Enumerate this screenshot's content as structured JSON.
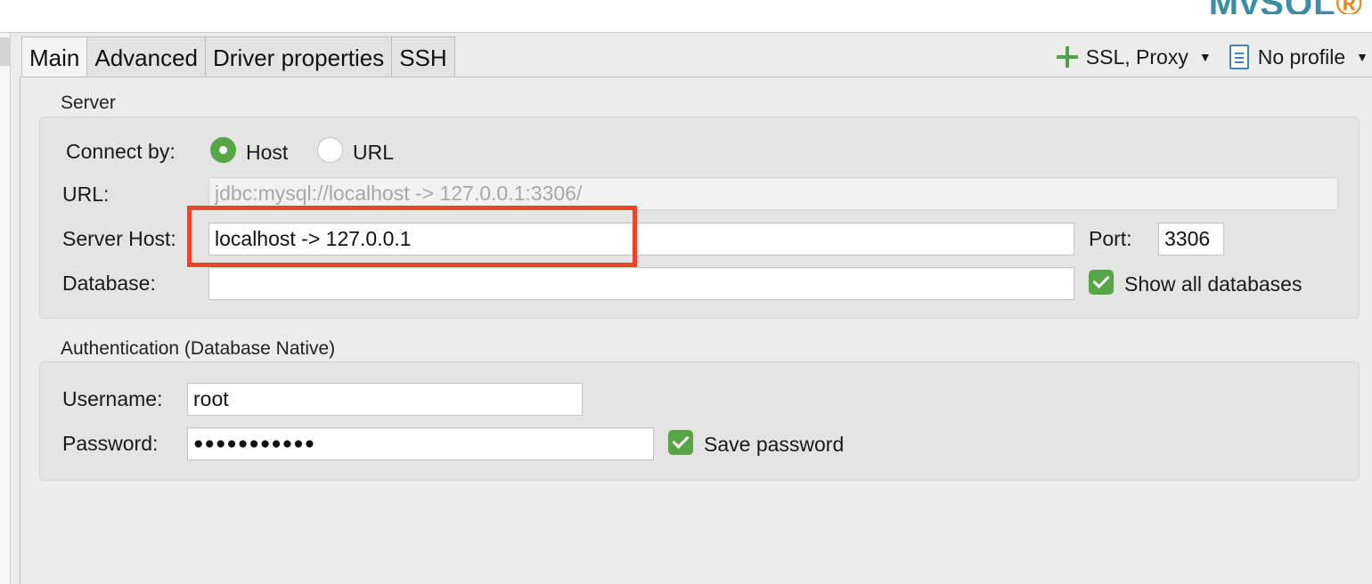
{
  "brand": {
    "text_main": "MySQL",
    "accent_color": "#3d8ea3"
  },
  "tabs": [
    {
      "label": "Main",
      "active": true
    },
    {
      "label": "Advanced",
      "active": false
    },
    {
      "label": "Driver properties",
      "active": false
    },
    {
      "label": "SSH",
      "active": false
    }
  ],
  "toolbar": {
    "ssl_proxy_label": "SSL, Proxy",
    "profile_label": "No profile",
    "plus_icon": "plus-icon",
    "profile_icon": "document-icon",
    "caret_icon": "▼"
  },
  "server": {
    "section_title": "Server",
    "connect_by_label": "Connect by:",
    "option_host": "Host",
    "option_url": "URL",
    "selected_option": "Host",
    "url_label": "URL:",
    "url_value": "jdbc:mysql://localhost -> 127.0.0.1:3306/",
    "host_label": "Server Host:",
    "host_value": "localhost -> 127.0.0.1",
    "port_label": "Port:",
    "port_value": "3306",
    "database_label": "Database:",
    "database_value": "",
    "show_all_label": "Show all databases",
    "show_all_checked": true
  },
  "auth": {
    "section_title": "Authentication (Database Native)",
    "username_label": "Username:",
    "username_value": "root",
    "password_label": "Password:",
    "password_value": "●●●●●●●●●●●",
    "save_password_label": "Save password",
    "save_password_checked": true
  },
  "colors": {
    "accent_green": "#58a548",
    "highlight_red": "#e8452c",
    "background": "#ececec"
  }
}
